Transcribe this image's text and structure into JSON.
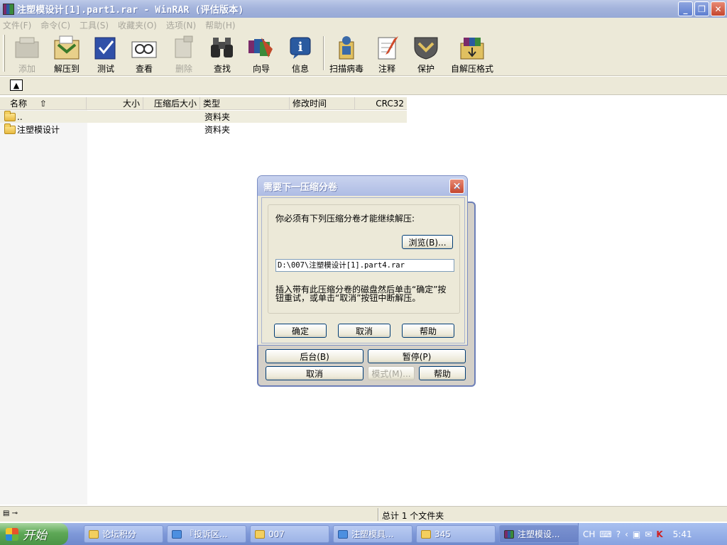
{
  "window": {
    "title": "注塑模设计[1].part1.rar - WinRAR (评估版本)"
  },
  "menu": [
    "文件(F)",
    "命令(C)",
    "工具(S)",
    "收藏夹(O)",
    "选项(N)",
    "帮助(H)"
  ],
  "toolbar": {
    "add": "添加",
    "extract": "解压到",
    "test": "测试",
    "view": "查看",
    "delete": "删除",
    "find": "查找",
    "wizard": "向导",
    "info": "信息",
    "scan": "扫描病毒",
    "comment": "注释",
    "protect": "保护",
    "sfx": "自解压格式"
  },
  "list": {
    "columns": [
      "名称",
      "大小",
      "压缩后大小",
      "类型",
      "修改时间",
      "CRC32"
    ],
    "rows": [
      {
        "name": "..",
        "type": "资料夹"
      },
      {
        "name": "注塑模设计",
        "type": "资料夹"
      }
    ]
  },
  "status": {
    "summary": "总计 1 个文件夹"
  },
  "dialog": {
    "title": "需要下一压缩分卷",
    "message": "你必须有下列压缩分卷才能继续解压:",
    "browse": "浏览(B)...",
    "path": "D:\\007\\注塑模设计[1].part4.rar",
    "instruction1": "插入带有此压缩分卷的磁盘然后单击“确定”按",
    "instruction2": "钮重试，或单击“取消”按钮中断解压。",
    "ok": "确定",
    "cancel": "取消",
    "help": "帮助"
  },
  "progress_dialog": {
    "background": "后台(B)",
    "pause": "暂停(P)",
    "cancel": "取消",
    "mode": "模式(M)...",
    "help": "帮助"
  },
  "taskbar": {
    "start": "开始",
    "tasks": [
      "论坛积分",
      "『投诉区...",
      "007",
      "注塑模具...",
      "345",
      "注塑模设..."
    ],
    "tray_lang": "CH",
    "clock": "5:41"
  },
  "colors": {
    "accent": "#7a8dc3",
    "start_green": "#5ea857",
    "taskbar_blue": "#7e98d8"
  }
}
